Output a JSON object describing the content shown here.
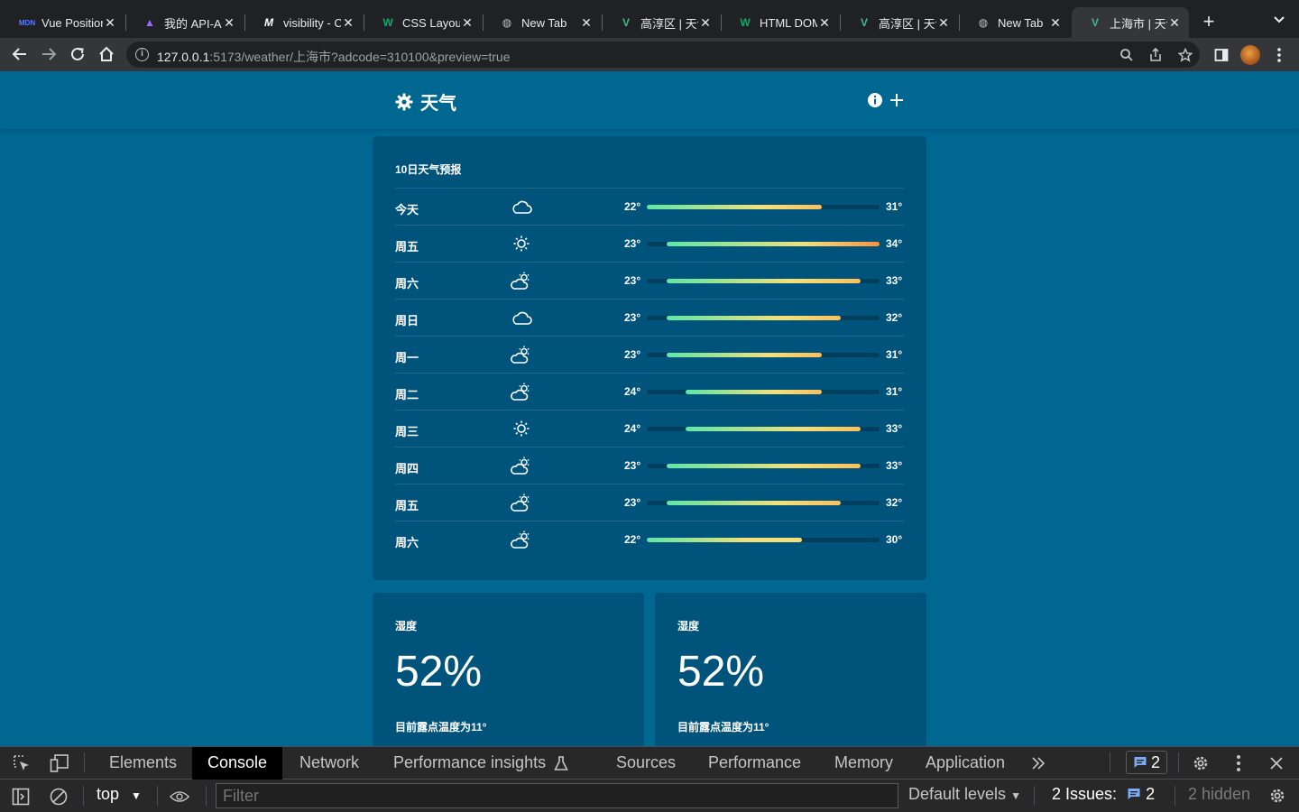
{
  "browser": {
    "tabs": [
      {
        "title": "Vue Position",
        "favicon": "mdn-logo"
      },
      {
        "title": "我的 API-AP",
        "favicon": "apifox-logo"
      },
      {
        "title": "visibility - C",
        "favicon": "mdn-logo"
      },
      {
        "title": "CSS Layout",
        "favicon": "w3schools-logo"
      },
      {
        "title": "New Tab",
        "favicon": "globe-icon"
      },
      {
        "title": "高淳区 | 天气",
        "favicon": "vue-logo"
      },
      {
        "title": "HTML DOM",
        "favicon": "w3schools-logo"
      },
      {
        "title": "高淳区 | 天气",
        "favicon": "vue-logo"
      },
      {
        "title": "New Tab",
        "favicon": "globe-icon"
      },
      {
        "title": "上海市 | 天气",
        "favicon": "vue-logo",
        "active": true
      }
    ],
    "url_host": "127.0.0.1",
    "url_rest": ":5173/weather/上海市?adcode=310100&preview=true"
  },
  "app": {
    "title": "天气"
  },
  "forecast": {
    "title": "10日天气预报",
    "scale_min": 22,
    "scale_max": 34,
    "days": [
      {
        "day": "今天",
        "icon": "cloudy-icon",
        "low": "22°",
        "high": "31°",
        "lo": 22,
        "hi": 31
      },
      {
        "day": "周五",
        "icon": "sunny-icon",
        "low": "23°",
        "high": "34°",
        "lo": 23,
        "hi": 34
      },
      {
        "day": "周六",
        "icon": "partly-cloudy-icon",
        "low": "23°",
        "high": "33°",
        "lo": 23,
        "hi": 33
      },
      {
        "day": "周日",
        "icon": "cloudy-icon",
        "low": "23°",
        "high": "32°",
        "lo": 23,
        "hi": 32
      },
      {
        "day": "周一",
        "icon": "partly-cloudy-icon",
        "low": "23°",
        "high": "31°",
        "lo": 23,
        "hi": 31
      },
      {
        "day": "周二",
        "icon": "partly-cloudy-icon",
        "low": "24°",
        "high": "31°",
        "lo": 24,
        "hi": 31
      },
      {
        "day": "周三",
        "icon": "sunny-icon",
        "low": "24°",
        "high": "33°",
        "lo": 24,
        "hi": 33
      },
      {
        "day": "周四",
        "icon": "partly-cloudy-icon",
        "low": "23°",
        "high": "33°",
        "lo": 23,
        "hi": 33
      },
      {
        "day": "周五",
        "icon": "partly-cloudy-icon",
        "low": "23°",
        "high": "32°",
        "lo": 23,
        "hi": 32
      },
      {
        "day": "周六",
        "icon": "partly-cloudy-icon",
        "low": "22°",
        "high": "30°",
        "lo": 22,
        "hi": 30
      }
    ]
  },
  "humidity_cards": [
    {
      "title": "湿度",
      "value": "52%",
      "desc": "目前露点温度为11°"
    },
    {
      "title": "湿度",
      "value": "52%",
      "desc": "目前露点温度为11°"
    }
  ],
  "devtools": {
    "tabs": [
      "Elements",
      "Console",
      "Network",
      "Performance insights",
      "Sources",
      "Performance",
      "Memory",
      "Application"
    ],
    "active_tab": "Console",
    "message_count": "2",
    "context": "top",
    "filter_placeholder": "Filter",
    "levels": "Default levels",
    "issues_label": "2 Issues:",
    "issues_count": "2",
    "hidden": "2 hidden"
  },
  "colors": {
    "page_bg": "#006791",
    "card_bg": "#00547b",
    "temp_cool": "#5ee6a6",
    "temp_mid": "#f3e07a",
    "temp_hot": "#fb923c"
  }
}
